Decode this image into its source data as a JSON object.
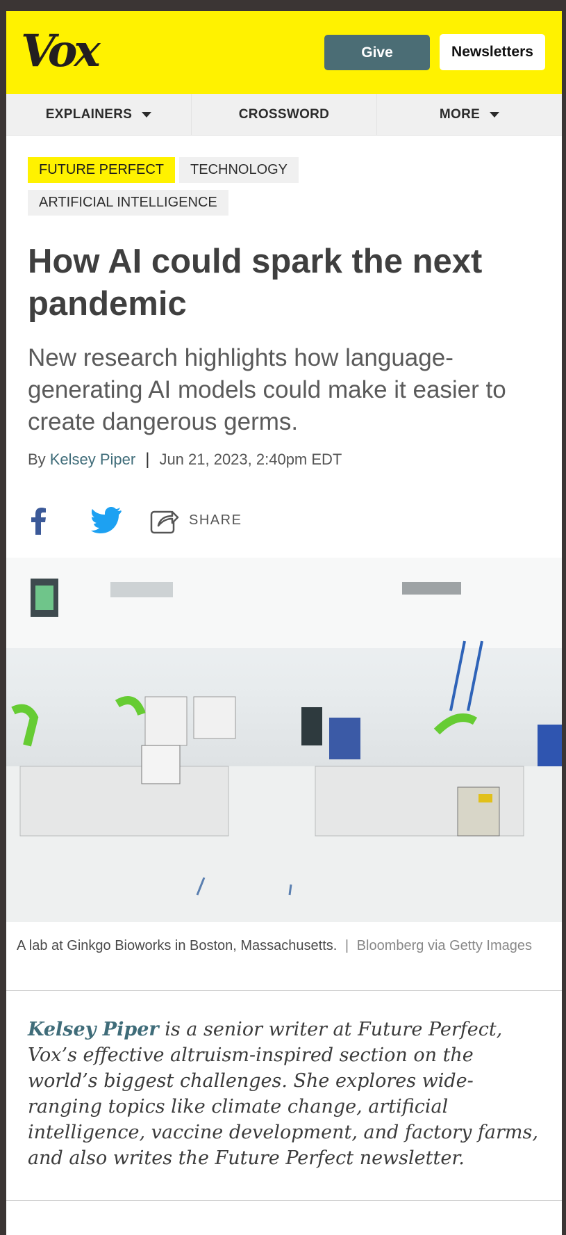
{
  "header": {
    "logo": "Vox",
    "give_label": "Give",
    "newsletters_label": "Newsletters"
  },
  "nav": {
    "items": [
      {
        "label": "EXPLAINERS",
        "has_caret": true
      },
      {
        "label": "CROSSWORD",
        "has_caret": false
      },
      {
        "label": "MORE",
        "has_caret": true
      }
    ]
  },
  "tags": [
    "FUTURE PERFECT",
    "TECHNOLOGY",
    "ARTIFICIAL INTELLIGENCE"
  ],
  "article": {
    "headline": "How AI could spark the next pandemic",
    "dek": "New research highlights how language-generating AI models could make it easier to create dangerous germs.",
    "byline_prefix": "By",
    "author": "Kelsey Piper",
    "separator": "|",
    "date": "Jun 21, 2023, 2:40pm EDT"
  },
  "share": {
    "label": "SHARE"
  },
  "image": {
    "caption": "A lab at Ginkgo Bioworks in Boston, Massachusetts.",
    "caption_separator": "|",
    "credit": "Bloomberg via Getty Images"
  },
  "bio": {
    "name": "Kelsey Piper",
    "text": " is a senior writer at Future Perfect, Vox’s effective altruism-inspired section on the world’s biggest challenges. She explores wide-ranging topics like climate change, artificial intelligence, vaccine development, and factory farms, and also writes the Future Perfect newsletter."
  },
  "colors": {
    "brand_yellow": "#fff200",
    "give_button": "#4b6d75",
    "link": "#3f6c79",
    "facebook": "#3b5998",
    "twitter": "#1da1f2"
  }
}
